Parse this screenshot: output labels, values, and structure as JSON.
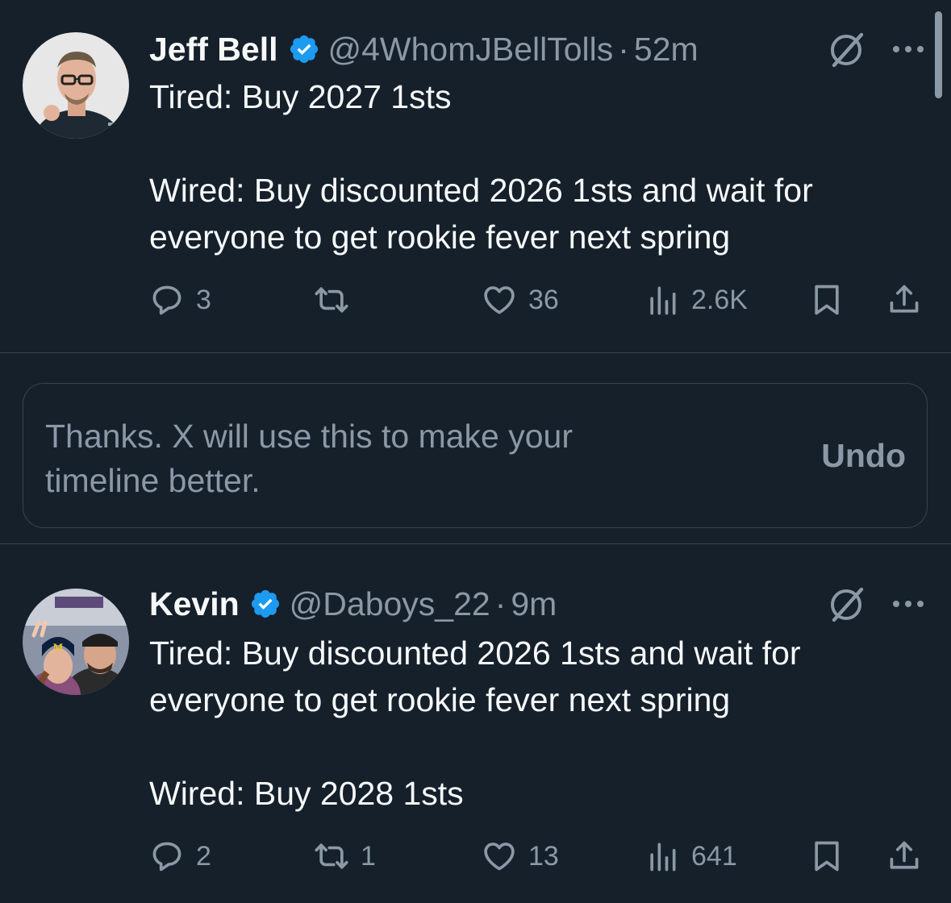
{
  "tweets": [
    {
      "name": "Jeff Bell",
      "handle": "@4WhomJBellTolls",
      "separator": "·",
      "time": "52m",
      "text": "Tired: Buy 2027 1sts\n\nWired: Buy discounted 2026 1sts and wait for everyone to get rookie fever next spring",
      "replies": "3",
      "retweets": "",
      "likes": "36",
      "views": "2.6K"
    },
    {
      "name": "Kevin",
      "handle": "@Daboys_22",
      "separator": "·",
      "time": "9m",
      "text": "Tired: Buy discounted 2026 1sts and wait for everyone to get rookie fever next spring\n\nWired: Buy 2028 1sts",
      "replies": "2",
      "retweets": "1",
      "likes": "13",
      "views": "641"
    }
  ],
  "notice": {
    "text": "Thanks. X will use this to make your timeline better.",
    "undo_label": "Undo"
  },
  "colors": {
    "background": "#15202b",
    "text_primary": "#f7f9f9",
    "text_secondary": "#8b98a5",
    "verified": "#1d9bf0",
    "divider": "#38444d"
  },
  "icons": {
    "verified": "verified-badge-icon",
    "grok": "grok-icon",
    "more": "more-icon",
    "reply": "reply-icon",
    "retweet": "retweet-icon",
    "like": "like-icon",
    "views": "views-icon",
    "bookmark": "bookmark-icon",
    "share": "share-icon"
  }
}
